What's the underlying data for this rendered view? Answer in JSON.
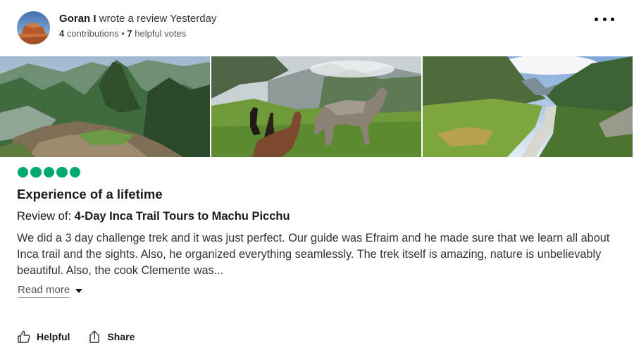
{
  "review": {
    "author": {
      "name": "Goran I",
      "action": "wrote a review Yesterday",
      "contributions_count": "4",
      "contributions_label": "contributions",
      "separator": "•",
      "helpful_count": "7",
      "helpful_label": "helpful votes",
      "avatar_icon": "avatar-desert-mesa-photo"
    },
    "more_icon": "more-options-icon",
    "photos": [
      {
        "subject": "machu-picchu-ruins-photo"
      },
      {
        "subject": "llamas-photo"
      },
      {
        "subject": "river-valley-photo"
      }
    ],
    "rating": {
      "value": 5,
      "max": 5,
      "color": "#00aa6c"
    },
    "title": "Experience of a lifetime",
    "review_of_label": "Review of:",
    "review_of_name": "4-Day Inca Trail Tours to Machu Picchu",
    "body": "We did a 3 day challenge trek and it was just perfect. Our guide was Efraim and he made sure that we learn all about Inca trail and the sights. Also, he organized everything seamlessly. The trek itself is amazing, nature is unbelievably beautiful. Also, the cook Clemente was...",
    "read_more": "Read more",
    "actions": {
      "helpful": {
        "label": "Helpful",
        "icon": "thumbs-up-icon"
      },
      "share": {
        "label": "Share",
        "icon": "share-icon"
      }
    }
  }
}
